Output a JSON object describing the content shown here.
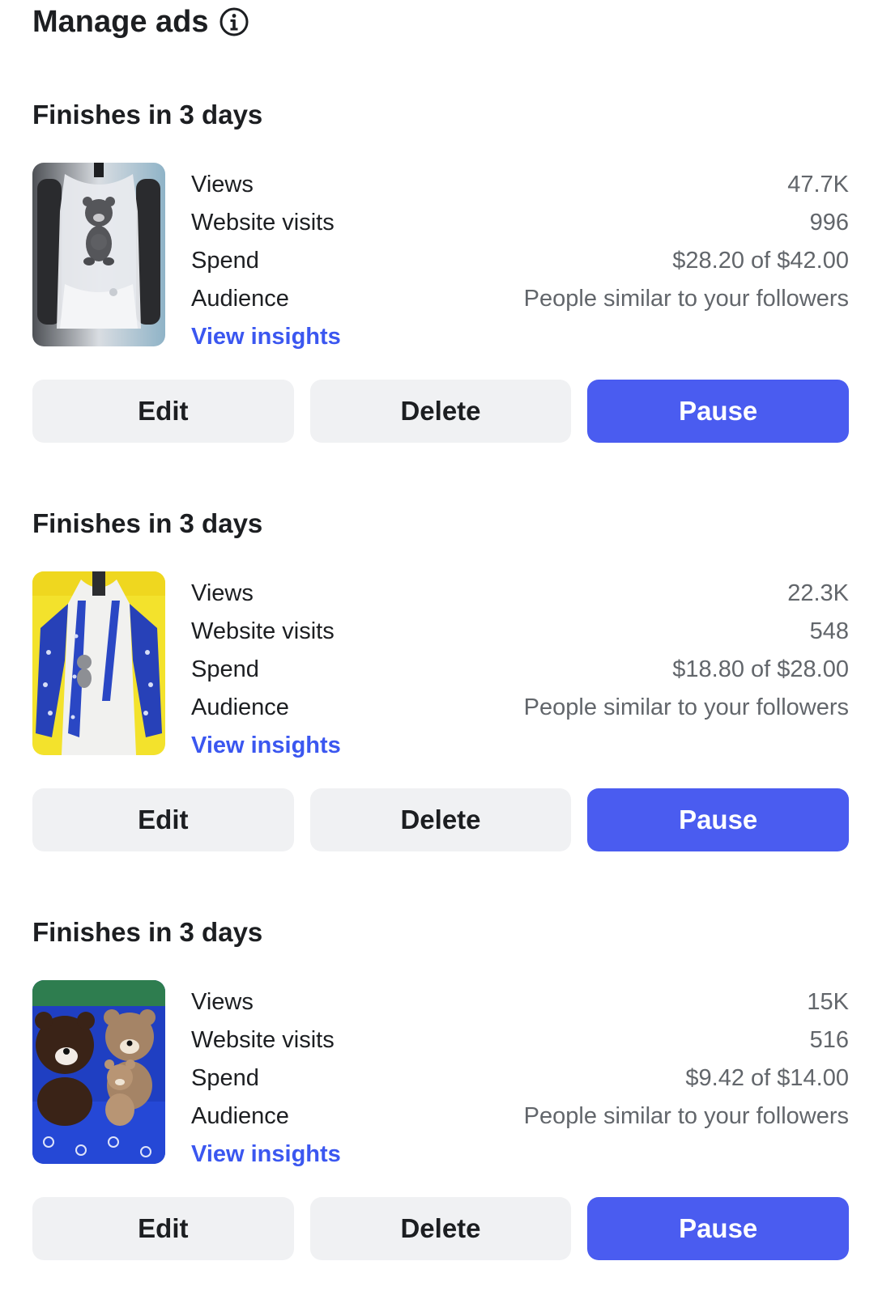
{
  "header": {
    "title": "Manage ads",
    "info_icon": "info-icon"
  },
  "colors": {
    "accent": "#4a5cf0",
    "link": "#3b57f0",
    "button_bg": "#f0f1f3",
    "muted_text": "#62666b"
  },
  "ads": [
    {
      "status": "Finishes in 3 days",
      "thumbnail": "lace-top-with-bear-photo",
      "stats": [
        {
          "label": "Views",
          "value": "47.7K"
        },
        {
          "label": "Website visits",
          "value": "996"
        },
        {
          "label": "Spend",
          "value": "$28.20 of $42.00"
        },
        {
          "label": "Audience",
          "value": "People similar to your followers"
        }
      ],
      "insights_label": "View insights",
      "buttons": {
        "edit": "Edit",
        "delete": "Delete",
        "pause": "Pause"
      }
    },
    {
      "status": "Finishes in 3 days",
      "thumbnail": "blue-patterned-dress-photo",
      "stats": [
        {
          "label": "Views",
          "value": "22.3K"
        },
        {
          "label": "Website visits",
          "value": "548"
        },
        {
          "label": "Spend",
          "value": "$18.80 of $28.00"
        },
        {
          "label": "Audience",
          "value": "People similar to your followers"
        }
      ],
      "insights_label": "View insights",
      "buttons": {
        "edit": "Edit",
        "delete": "Delete",
        "pause": "Pause"
      }
    },
    {
      "status": "Finishes in 3 days",
      "thumbnail": "crochet-bears-photo",
      "stats": [
        {
          "label": "Views",
          "value": "15K"
        },
        {
          "label": "Website visits",
          "value": "516"
        },
        {
          "label": "Spend",
          "value": "$9.42 of $14.00"
        },
        {
          "label": "Audience",
          "value": "People similar to your followers"
        }
      ],
      "insights_label": "View insights",
      "buttons": {
        "edit": "Edit",
        "delete": "Delete",
        "pause": "Pause"
      }
    }
  ]
}
